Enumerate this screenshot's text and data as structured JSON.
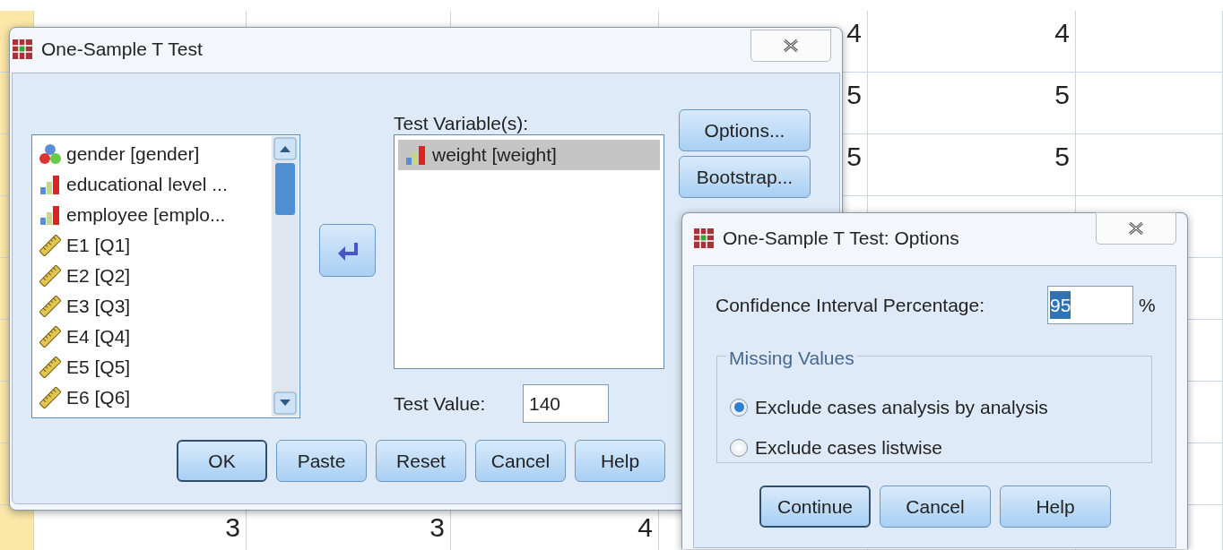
{
  "spreadsheet": {
    "rows": [
      {
        "cells": [
          "",
          "",
          "",
          "4",
          "4",
          ""
        ]
      },
      {
        "cells": [
          "",
          "",
          "",
          "5",
          "5",
          ""
        ]
      },
      {
        "cells": [
          "",
          "",
          "",
          "5",
          "5",
          ""
        ]
      },
      {
        "cells": [
          "",
          "",
          "",
          "",
          "",
          ""
        ]
      },
      {
        "cells": [
          "",
          "",
          "",
          "",
          "",
          ""
        ]
      },
      {
        "cells": [
          "",
          "",
          "",
          "",
          "",
          ""
        ]
      },
      {
        "cells": [
          "",
          "",
          "",
          "",
          "",
          ""
        ]
      },
      {
        "cells": [
          "",
          "",
          "",
          "",
          "",
          ""
        ]
      },
      {
        "cells": [
          "3",
          "3",
          "4",
          "",
          "",
          ""
        ]
      }
    ]
  },
  "main_dialog": {
    "title": "One-Sample T Test",
    "variables": [
      {
        "label": "gender [gender]",
        "kind": "nominal"
      },
      {
        "label": "educational level ...",
        "kind": "ordinal"
      },
      {
        "label": "employee [emplo...",
        "kind": "ordinal"
      },
      {
        "label": "E1 [Q1]",
        "kind": "scale"
      },
      {
        "label": "E2 [Q2]",
        "kind": "scale"
      },
      {
        "label": "E3 [Q3]",
        "kind": "scale"
      },
      {
        "label": "E4 [Q4]",
        "kind": "scale"
      },
      {
        "label": "E5 [Q5]",
        "kind": "scale"
      },
      {
        "label": "E6 [Q6]",
        "kind": "scale"
      }
    ],
    "test_variables_label": {
      "label": "Test Variable(s):"
    },
    "test_variables": [
      {
        "label": "weight [weight]",
        "kind": "ordinal",
        "selected": true
      }
    ],
    "test_value": {
      "label": "Test Value:",
      "value": "140"
    },
    "side_buttons": [
      {
        "label": "Options..."
      },
      {
        "label": "Bootstrap..."
      }
    ],
    "buttons": [
      {
        "label": "OK",
        "default": true
      },
      {
        "label": "Paste",
        "default": false
      },
      {
        "label": "Reset",
        "default": false
      },
      {
        "label": "Cancel",
        "default": false
      },
      {
        "label": "Help",
        "default": false
      }
    ]
  },
  "options_dialog": {
    "title": "One-Sample T Test: Options",
    "confidence": {
      "label": "Confidence Interval Percentage:",
      "value": "95",
      "text_selected": true,
      "unit": "%"
    },
    "missing_values": {
      "legend": "Missing Values",
      "options": [
        {
          "label": "Exclude cases analysis by analysis",
          "selected": true
        },
        {
          "label": "Exclude cases listwise",
          "selected": false
        }
      ]
    },
    "buttons": [
      {
        "label": "Continue",
        "default": true
      },
      {
        "label": "Cancel",
        "default": false
      },
      {
        "label": "Help",
        "default": false
      }
    ]
  }
}
